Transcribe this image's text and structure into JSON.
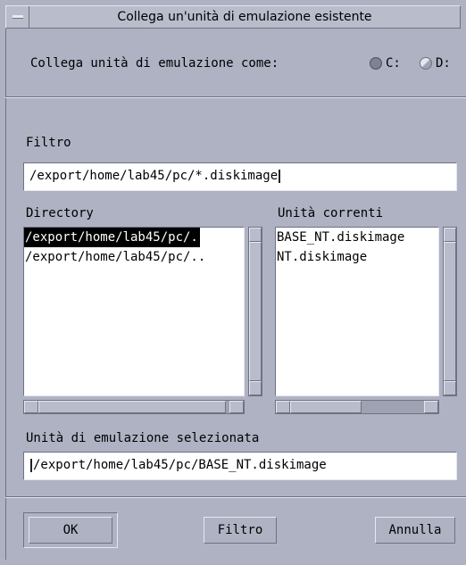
{
  "window": {
    "title": "Collega un'unità di emulazione esistente"
  },
  "connect": {
    "label": "Collega unità di emulazione come:",
    "options": [
      {
        "label": "C:",
        "selected": true
      },
      {
        "label": "D:",
        "selected": false
      }
    ]
  },
  "filter": {
    "label": "Filtro",
    "value": "/export/home/lab45/pc/*.diskimage"
  },
  "directory": {
    "label": "Directory",
    "items": [
      "/export/home/lab45/pc/.",
      "/export/home/lab45/pc/.."
    ],
    "selected_index": 0
  },
  "drives": {
    "label": "Unità correnti",
    "items": [
      "BASE_NT.diskimage",
      "NT.diskimage"
    ]
  },
  "selection": {
    "label": "Unità di emulazione selezionata",
    "value": "/export/home/lab45/pc/BASE_NT.diskimage"
  },
  "buttons": {
    "ok": "OK",
    "filter": "Filtro",
    "cancel": "Annulla"
  },
  "colors": {
    "background": "#aeb2c3",
    "field": "#ffffff",
    "selection": "#000000"
  },
  "icons": [
    "window-menu-icon",
    "scroll-up-arrow-icon",
    "scroll-down-arrow-icon",
    "scroll-left-arrow-icon",
    "scroll-right-arrow-icon",
    "radio-icon"
  ]
}
